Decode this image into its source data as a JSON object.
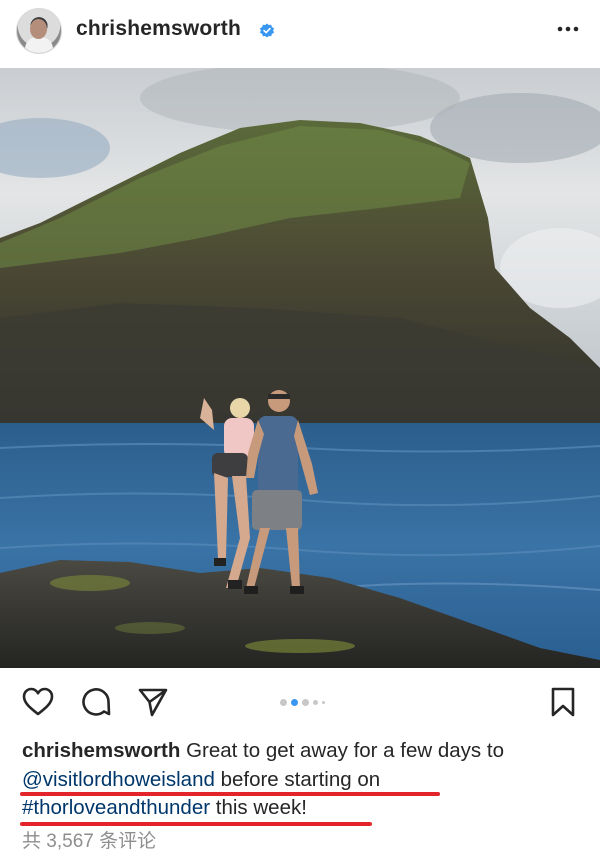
{
  "post": {
    "username": "chrishemsworth",
    "caption_lead": "Great to get away for a few days to",
    "mention": "@visitlordhoweisland",
    "caption_mid": " before starting on",
    "hashtag": "#thorloveandthunder",
    "caption_end": " this week!",
    "comments_text": "共 3,567 条评论"
  },
  "carousel": {
    "count": 5,
    "active_index": 1
  },
  "icons": {
    "verified": "verified-badge-icon",
    "more": "more-options-icon",
    "like": "heart-icon",
    "comment": "comment-icon",
    "share": "share-icon",
    "save": "bookmark-icon"
  },
  "colors": {
    "verified": "#3897f0",
    "link": "#00376b",
    "annotation": "#e3242b",
    "muted": "#8e8e8e"
  }
}
